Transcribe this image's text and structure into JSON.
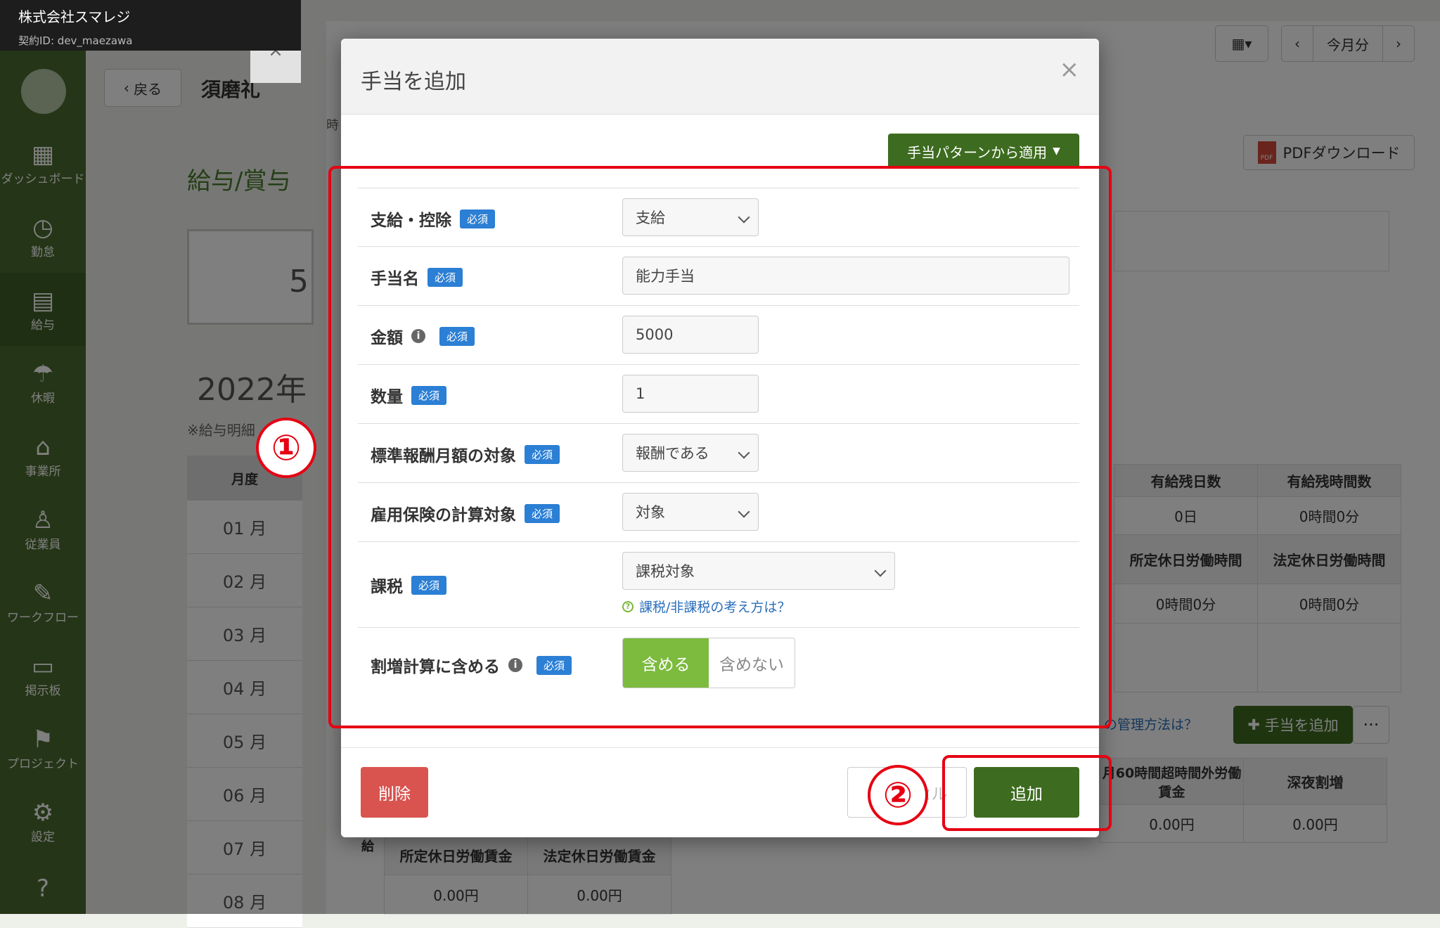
{
  "company": {
    "name": "株式会社スマレジ",
    "contract_id": "契約ID: dev_maezawa"
  },
  "sidebar": {
    "items": [
      {
        "label": "ダッシュボード",
        "icon": "dashboard-icon",
        "glyph": "▦"
      },
      {
        "label": "勤怠",
        "icon": "clock-icon",
        "glyph": "◷"
      },
      {
        "label": "給与",
        "icon": "calculator-icon",
        "glyph": "▤"
      },
      {
        "label": "休暇",
        "icon": "umbrella-icon",
        "glyph": "☂"
      },
      {
        "label": "事業所",
        "icon": "home-icon",
        "glyph": "⌂"
      },
      {
        "label": "従業員",
        "icon": "user-icon",
        "glyph": "♙"
      },
      {
        "label": "ワークフロー",
        "icon": "workflow-icon",
        "glyph": "✎"
      },
      {
        "label": "掲示板",
        "icon": "chat-icon",
        "glyph": "▭"
      },
      {
        "label": "プロジェクト",
        "icon": "flag-icon",
        "glyph": "⚑"
      },
      {
        "label": "設定",
        "icon": "gear-icon",
        "glyph": "⚙"
      },
      {
        "label": "",
        "icon": "help-icon",
        "glyph": "?"
      }
    ]
  },
  "page": {
    "back_label": "戻る",
    "employee_name": "須磨礼",
    "section_title": "給与/賞与",
    "stat_value": "5",
    "year_label": "2022年",
    "note": "※給与明細",
    "month_header": "月度",
    "months": [
      "01 月",
      "02 月",
      "03 月",
      "04 月",
      "05 月",
      "06 月",
      "07 月",
      "08 月"
    ],
    "period_label": "今月分",
    "time_char": "時",
    "pdf_label": "PDFダウンロード",
    "pdf_icon_text": "PDF",
    "leave_headers": [
      "有給残日数",
      "有給残時間数"
    ],
    "leave_values": [
      "0日",
      "0時間0分"
    ],
    "holiday_headers": [
      "所定休日労働時間",
      "法定休日労働時間"
    ],
    "holiday_values": [
      "0時間0分",
      "0時間0分"
    ],
    "mgmt_link": "の管理方法は？",
    "add_allowance_label": "手当を追加",
    "more_label": "···",
    "overtime_headers": [
      "月60時間超時間外労働賃金",
      "深夜割増"
    ],
    "overtime_values": [
      "0.00円",
      "0.00円"
    ],
    "bottom_side": "給",
    "bottom_headers": [
      "所定休日労働賃金",
      "法定休日労働賃金"
    ],
    "bottom_values": [
      "0.00円",
      "0.00円"
    ]
  },
  "modal": {
    "title": "手当を追加",
    "close_glyph": "×",
    "pattern_button": "手当パターンから適用",
    "required_badge": "必須",
    "fields": {
      "type": {
        "label": "支給・控除",
        "value": "支給"
      },
      "name": {
        "label": "手当名",
        "value": "能力手当"
      },
      "amount": {
        "label": "金額",
        "value": "5000"
      },
      "quantity": {
        "label": "数量",
        "value": "1"
      },
      "standard_remuneration": {
        "label": "標準報酬月額の対象",
        "value": "報酬である"
      },
      "employment_insurance": {
        "label": "雇用保険の計算対象",
        "value": "対象"
      },
      "taxation": {
        "label": "課税",
        "value": "課税対象",
        "help_link": "課税/非課税の考え方は？"
      },
      "overtime_include": {
        "label": "割増計算に含める",
        "on_label": "含める",
        "off_label": "含めない",
        "selected": "含める"
      }
    },
    "delete_label": "削除",
    "cancel_label": "キャンセル",
    "add_label": "追加"
  },
  "annotations": {
    "marker1": "①",
    "marker2": "②",
    "color": "#e60012"
  },
  "colors": {
    "brand_green": "#3d6b1f",
    "toggle_on": "#7cbb3e",
    "required_blue": "#2b7fd4",
    "danger": "#d9534f",
    "sidebar": "#4a6b2f"
  }
}
